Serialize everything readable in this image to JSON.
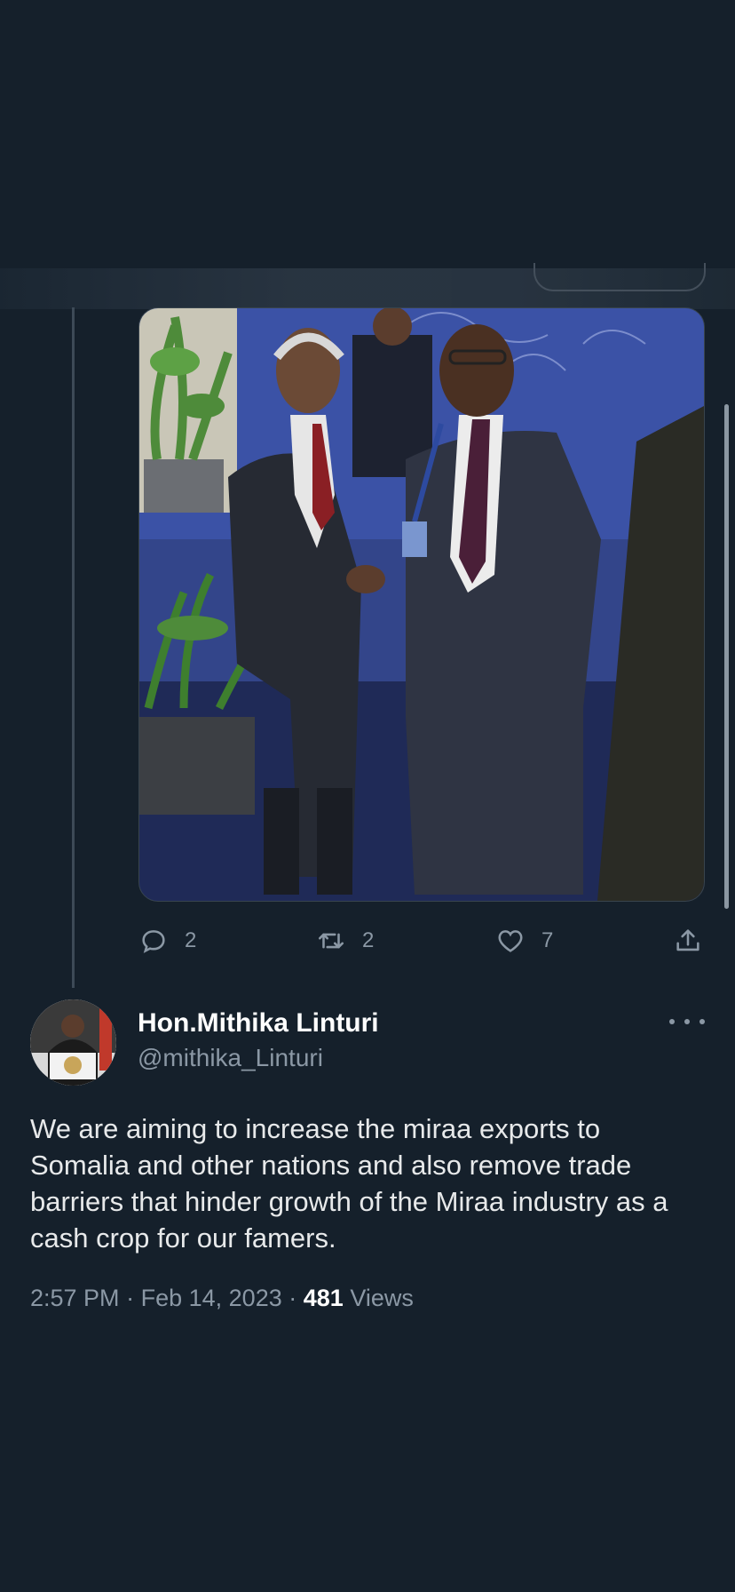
{
  "tweet": {
    "actions": {
      "replies": "2",
      "retweets": "2",
      "likes": "7"
    }
  },
  "author": {
    "display_name": "Hon.Mithika Linturi",
    "handle": "@mithika_Linturi"
  },
  "main_tweet": {
    "text": "We are aiming to increase the miraa exports to Somalia and other nations and also remove trade barriers that hinder growth of the Miraa industry as a cash crop for our famers.",
    "time": "2:57 PM",
    "separator": "·",
    "date": "Feb 14, 2023",
    "views_count": "481",
    "views_label": "Views"
  },
  "colors": {
    "background": "#15202b",
    "secondary_text": "#8b98a5",
    "primary_text": "#e7e9ea"
  },
  "icons": {
    "reply": "reply-icon",
    "retweet": "retweet-icon",
    "like": "heart-icon",
    "share": "share-icon",
    "more": "more-dots-icon"
  }
}
